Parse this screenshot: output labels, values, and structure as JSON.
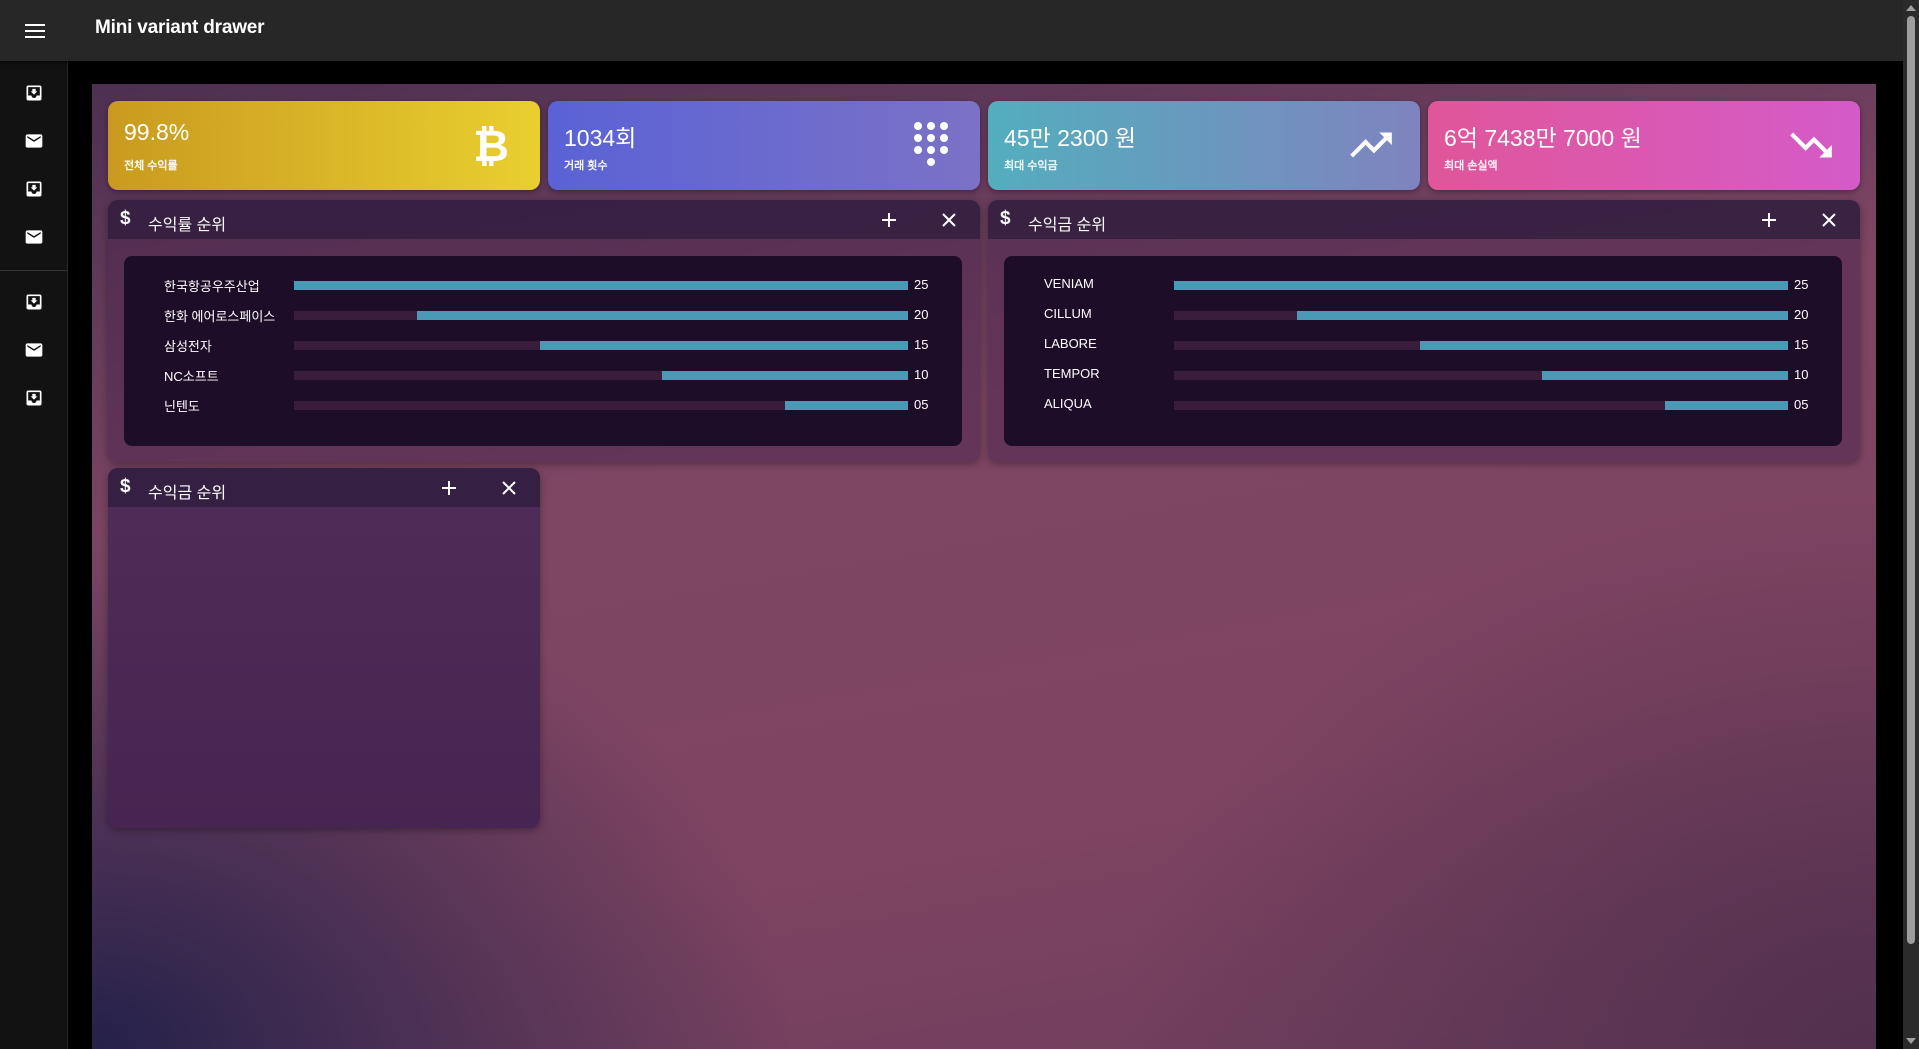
{
  "app": {
    "title": "Mini variant drawer"
  },
  "drawer": {
    "items": [
      {
        "icon": "move-to-inbox-icon"
      },
      {
        "icon": "mail-icon"
      },
      {
        "icon": "move-to-inbox-icon"
      },
      {
        "icon": "mail-icon"
      },
      {
        "icon": "move-to-inbox-icon"
      },
      {
        "icon": "mail-icon"
      },
      {
        "icon": "move-to-inbox-icon"
      }
    ]
  },
  "stats": [
    {
      "value": "99.8%",
      "label": "전체 수익률",
      "icon": "bitcoin-icon",
      "gradient": [
        "#c99a1f",
        "#e9cf30"
      ]
    },
    {
      "value": "1034회",
      "label": "거래 횟수",
      "icon": "dialpad-icon",
      "gradient": [
        "#5a62d6",
        "#7b72c6"
      ]
    },
    {
      "value": "45만 2300 원",
      "label": "최대 수익금",
      "icon": "trending-up-icon",
      "gradient": [
        "#53aebe",
        "#7f83bf"
      ]
    },
    {
      "value": "6억 7438만 7000 원",
      "label": "최대 손실액",
      "icon": "trending-down-icon",
      "gradient": [
        "#e0569a",
        "#d45bc8"
      ]
    }
  ],
  "widgets": [
    {
      "title": "수익률 순위",
      "chart_data": {
        "type": "bar",
        "categories": [
          "한국항공우주산업",
          "한화 에어로스페이스",
          "삼성전자",
          "NC소프트",
          "닌텐도"
        ],
        "values": [
          25,
          20,
          15,
          10,
          5
        ],
        "value_labels": [
          "25",
          "20",
          "15",
          "10",
          "05"
        ],
        "xlim": [
          0,
          25
        ]
      }
    },
    {
      "title": "수익금 순위",
      "chart_data": {
        "type": "bar",
        "categories": [
          "VENIAM",
          "CILLUM",
          "LABORE",
          "TEMPOR",
          "ALIQUA"
        ],
        "values": [
          25,
          20,
          15,
          10,
          5
        ],
        "value_labels": [
          "25",
          "20",
          "15",
          "10",
          "05"
        ],
        "xlim": [
          0,
          25
        ]
      }
    },
    {
      "title": "수익금 순위"
    }
  ],
  "colors": {
    "bar": "#4a9ab5",
    "bar_track": "#3a1d3c"
  }
}
